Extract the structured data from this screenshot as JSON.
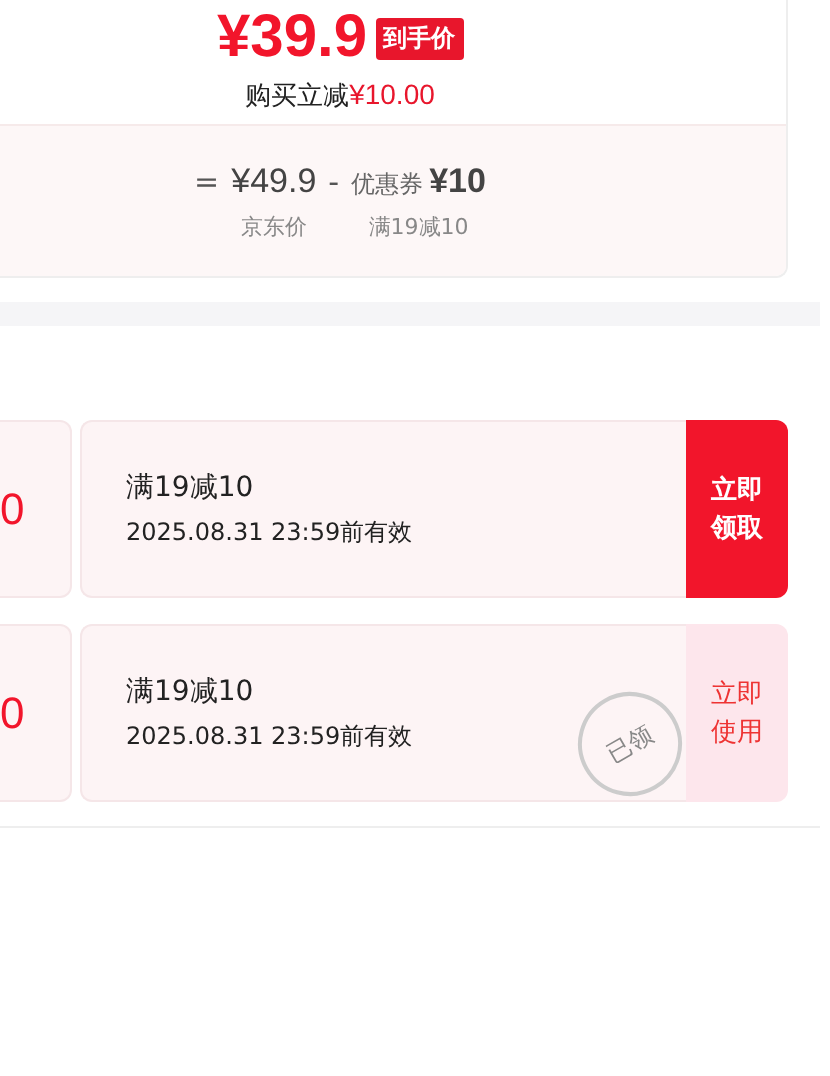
{
  "price_card": {
    "price": "¥39.9",
    "price_tag": "到手价",
    "discount_label": "购买立减",
    "discount_amount": "¥10.00",
    "formula": [
      {
        "kind": "operator",
        "text": "="
      },
      {
        "kind": "amount",
        "text": "¥49.9",
        "caption": "京东价"
      },
      {
        "kind": "operator",
        "text": "-"
      },
      {
        "kind": "coupon",
        "label": "优惠券",
        "text": "¥10",
        "caption": "满19减10"
      }
    ]
  },
  "coupons": [
    {
      "amount": "0",
      "title": "满19减10",
      "validity": "2025.08.31 23:59前有效",
      "action": "立即领取",
      "claimed": false
    },
    {
      "amount": "0",
      "title": "满19减10",
      "validity": "2025.08.31 23:59前有效",
      "action": "立即使用",
      "claimed": true,
      "stamp": "已领"
    }
  ]
}
